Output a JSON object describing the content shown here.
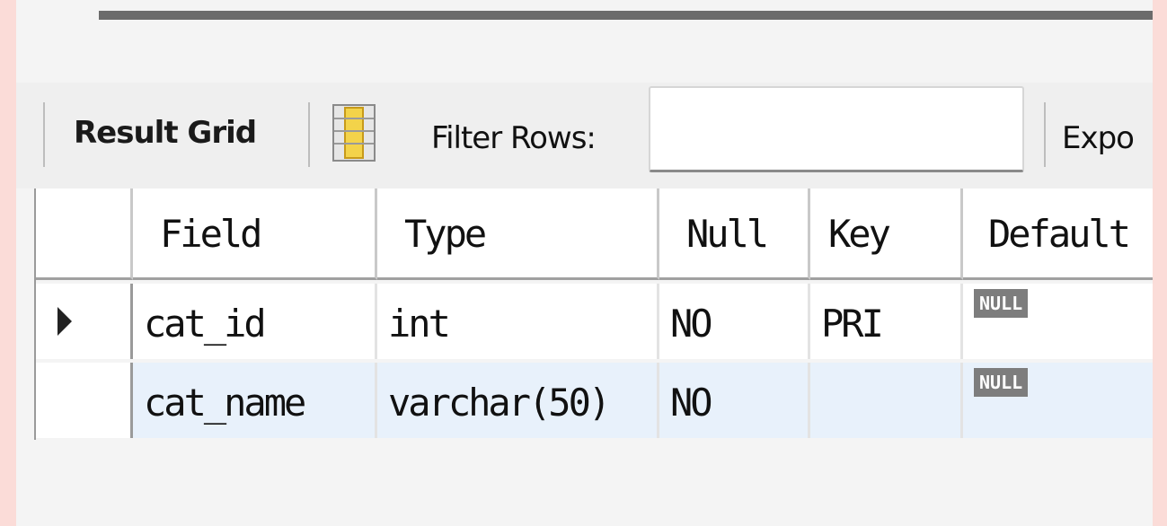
{
  "toolbar": {
    "result_grid_label": "Result Grid",
    "filter_rows_label": "Filter Rows:",
    "filter_value": "",
    "export_label": "Expo"
  },
  "grid": {
    "columns": [
      "",
      "Field",
      "Type",
      "Null",
      "Key",
      "Default"
    ],
    "rows": [
      {
        "selected": true,
        "cells": [
          "cat_id",
          "int",
          "NO",
          "PRI"
        ],
        "default": "NULL"
      },
      {
        "selected": false,
        "cells": [
          "cat_name",
          "varchar(50)",
          "NO",
          ""
        ],
        "default": "NULL"
      }
    ]
  },
  "colors": {
    "background": "#fbdcd8",
    "selected_row": "#e8f1fb",
    "null_badge": "#7d7d7d",
    "grid_icon_yellow": "#f3d34a"
  }
}
